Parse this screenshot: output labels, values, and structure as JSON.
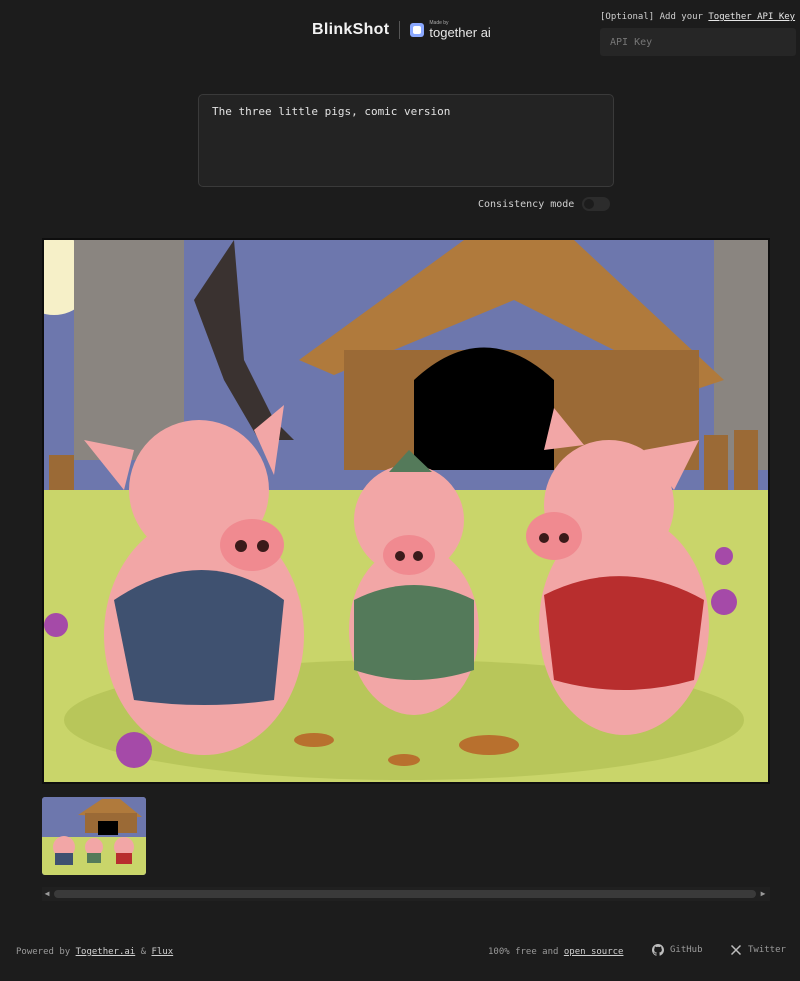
{
  "header": {
    "brand": "BlinkShot",
    "partner_made": "Made by",
    "partner_name": "together ai"
  },
  "api": {
    "label_prefix": "[Optional] Add your ",
    "label_link": "Together API Key",
    "placeholder": "API Key"
  },
  "prompt": {
    "value": "The three little pigs, comic version"
  },
  "consistency": {
    "label": "Consistency mode",
    "enabled": false
  },
  "gallery": {
    "selected_description": "generated image",
    "thumbnails": 1
  },
  "footer": {
    "powered_by": "Powered by ",
    "together_link": "Together.ai",
    "amp": " & ",
    "flux_link": "Flux",
    "free_text": "100% free and ",
    "open_source_link": "open source",
    "github": "GitHub",
    "twitter": "Twitter"
  },
  "colors": {
    "background": "#1c1c1c",
    "input": "#262626",
    "text": "#d6d6d6"
  }
}
